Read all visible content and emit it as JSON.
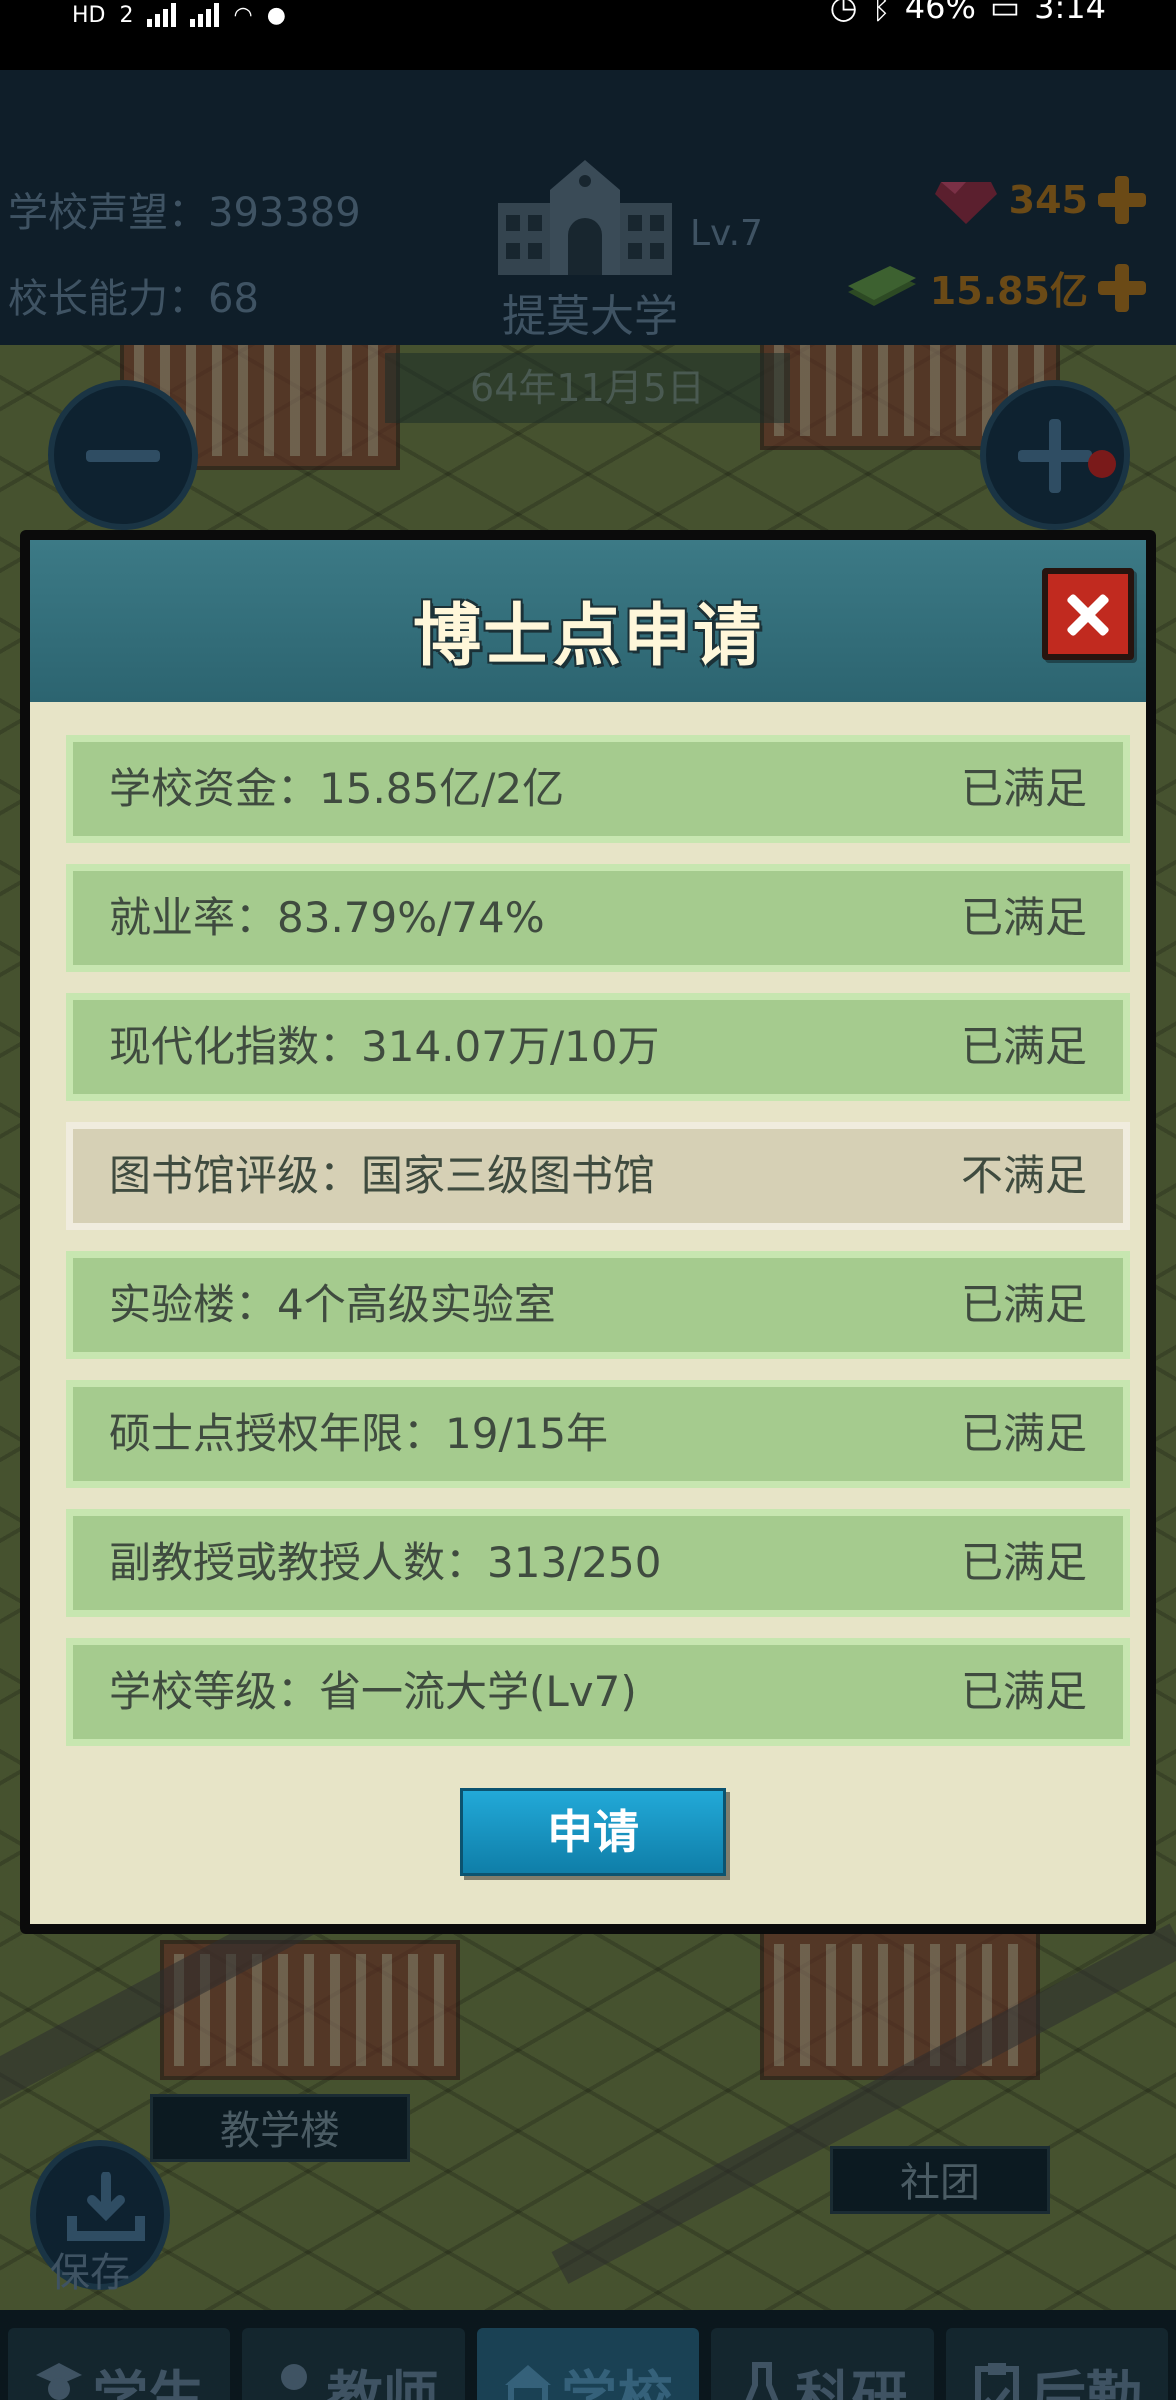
{
  "status_bar": {
    "left_hd": "HD",
    "left_sim": "2",
    "battery": "46%",
    "time": "3:14"
  },
  "hud": {
    "reputation": "学校声望：393389",
    "ability": "校长能力：68",
    "school_level": "Lv.7",
    "school_name": "提莫大学",
    "gems": "345",
    "money": "15.85亿",
    "date": "64年11月5日"
  },
  "dialog": {
    "title": "博士点申请",
    "requirements": [
      {
        "label": "学校资金：15.85亿/2亿",
        "status": "已满足"
      },
      {
        "label": "就业率：83.79%/74%",
        "status": "已满足"
      },
      {
        "label": "现代化指数：314.07万/10万",
        "status": "已满足"
      },
      {
        "label": "图书馆评级：国家三级图书馆",
        "status": "不满足"
      },
      {
        "label": "实验楼：4个高级实验室",
        "status": "已满足"
      },
      {
        "label": "硕士点授权年限：19/15年",
        "status": "已满足"
      },
      {
        "label": "副教授或教授人数：313/250",
        "status": "已满足"
      },
      {
        "label": "学校等级：省一流大学(Lv7)",
        "status": "已满足"
      }
    ],
    "apply_label": "申请"
  },
  "map": {
    "teaching_building": "教学楼",
    "club": "社团",
    "save_label": "保存"
  },
  "nav": [
    {
      "label": "学生",
      "icon": "student-icon"
    },
    {
      "label": "教师",
      "icon": "teacher-icon"
    },
    {
      "label": "学校",
      "icon": "school-icon",
      "active": true
    },
    {
      "label": "科研",
      "icon": "flask-icon"
    },
    {
      "label": "后勤",
      "icon": "clipboard-icon"
    }
  ],
  "colors": {
    "met_row": "#a5cb8e",
    "unmet_row": "#d6d0b5",
    "dialog_header": "#2c6470",
    "close_button": "#c12a1f",
    "apply_button": "#1596c4"
  }
}
